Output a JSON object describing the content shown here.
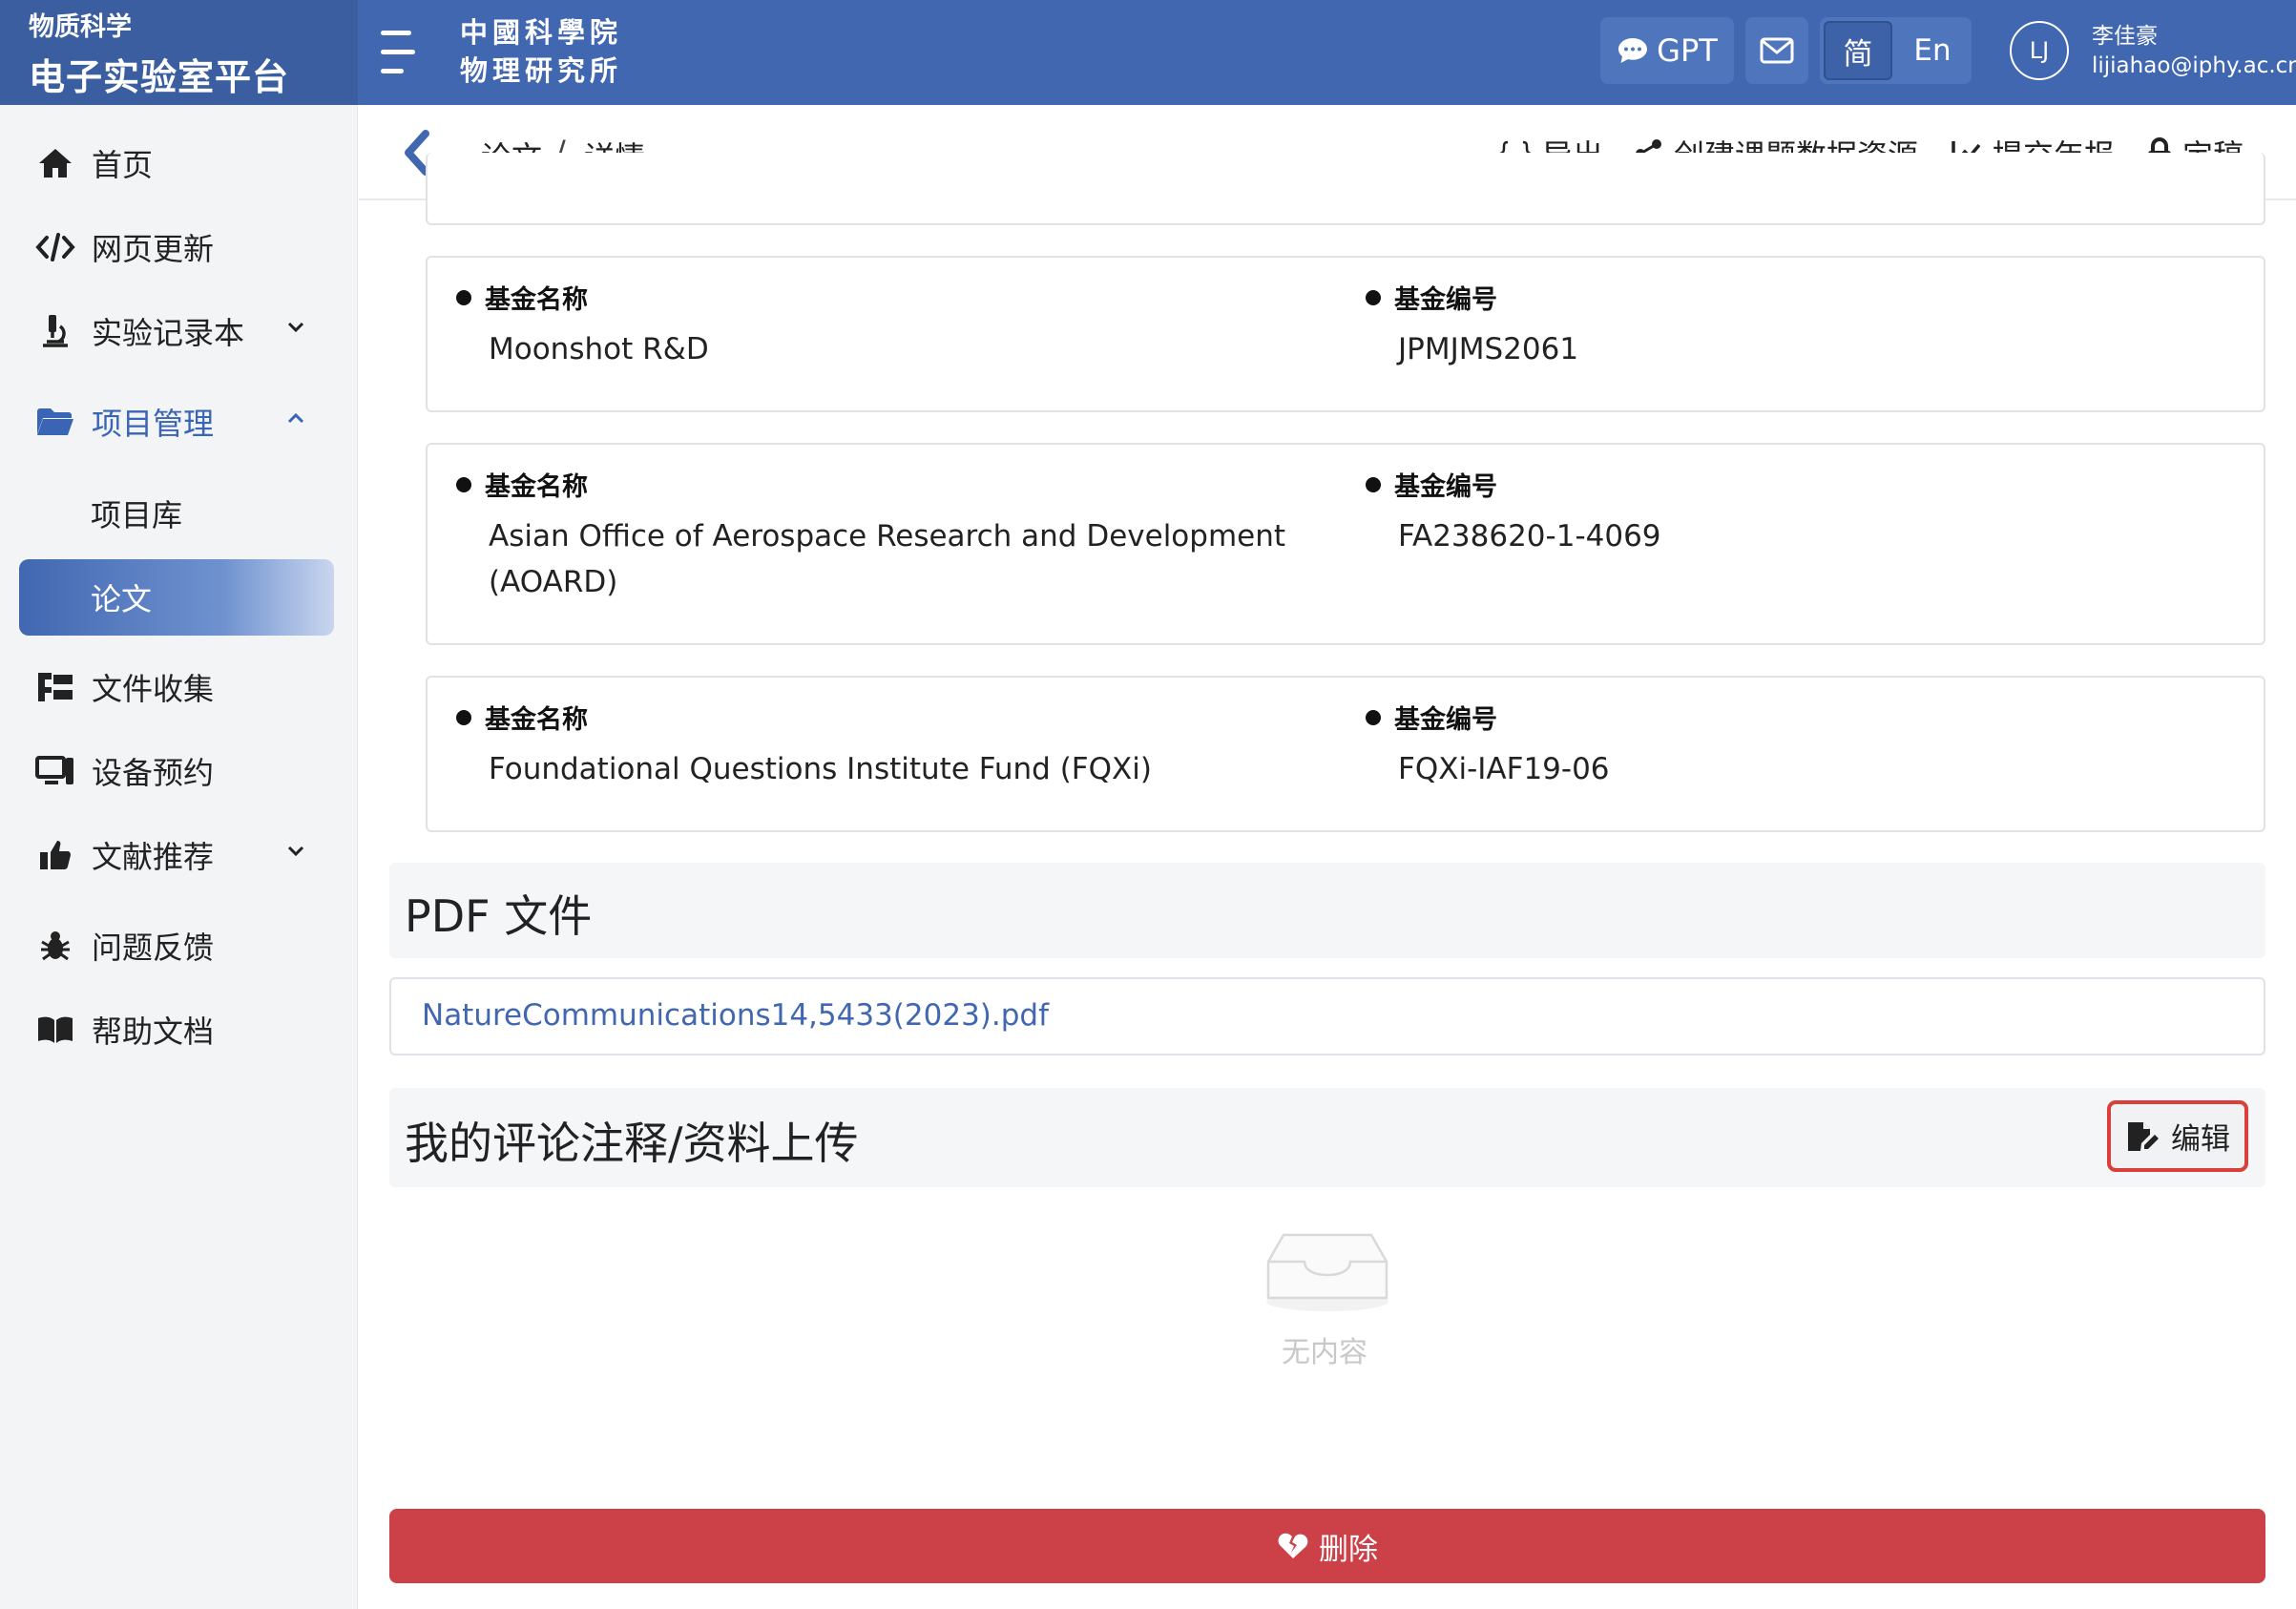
{
  "brand": {
    "subtitle": "物质科学",
    "title": "电子实验室平台"
  },
  "header": {
    "institute_line1": "中國科學院",
    "institute_line2": "物理研究所",
    "gpt_label": "GPT",
    "lang_options": [
      "简",
      "En"
    ],
    "lang_selected": "简",
    "user": {
      "initials": "LJ",
      "name": "李佳豪",
      "email": "lijiahao@iphy.ac.cn"
    }
  },
  "sidebar": {
    "items": [
      {
        "label": "首页",
        "icon": "home-icon"
      },
      {
        "label": "网页更新",
        "icon": "code-icon"
      },
      {
        "label": "实验记录本",
        "icon": "microscope-icon",
        "expandable": true
      },
      {
        "label": "项目管理",
        "icon": "folder-icon",
        "expanded": true
      },
      {
        "label": "项目库",
        "sub": true
      },
      {
        "label": "论文",
        "sub": true,
        "active": true
      },
      {
        "label": "文件收集",
        "icon": "tree-icon"
      },
      {
        "label": "设备预约",
        "icon": "desktop-icon"
      },
      {
        "label": "文献推荐",
        "icon": "thumbs-up-icon",
        "expandable": true
      },
      {
        "label": "问题反馈",
        "icon": "bug-icon"
      },
      {
        "label": "帮助文档",
        "icon": "book-icon"
      }
    ]
  },
  "breadcrumb": {
    "items": [
      "论文",
      "详情"
    ],
    "separator": "/"
  },
  "actions": {
    "export": "导出",
    "create_resource": "创建课题数据资源",
    "submit_report": "提交年报",
    "finalize": "定稿"
  },
  "funds": {
    "name_label": "基金名称",
    "number_label": "基金编号",
    "entries": [
      {
        "name": "Moonshot R&D",
        "number": "JPMJMS2061"
      },
      {
        "name": "Asian Office of Aerospace Research and Development (AOARD)",
        "number": "FA238620-1-4069"
      },
      {
        "name": "Foundational Questions Institute Fund (FQXi)",
        "number": "FQXi-IAF19-06"
      }
    ]
  },
  "pdf_section": {
    "title": "PDF 文件",
    "file_name": "NatureCommunications14,5433(2023).pdf"
  },
  "comments_section": {
    "title": "我的评论注释/资料上传",
    "edit_label": "编辑",
    "empty_text": "无内容"
  },
  "delete_label": "删除",
  "colors": {
    "primary": "#4167b1",
    "danger": "#cc4047",
    "highlight": "#d9403c"
  }
}
